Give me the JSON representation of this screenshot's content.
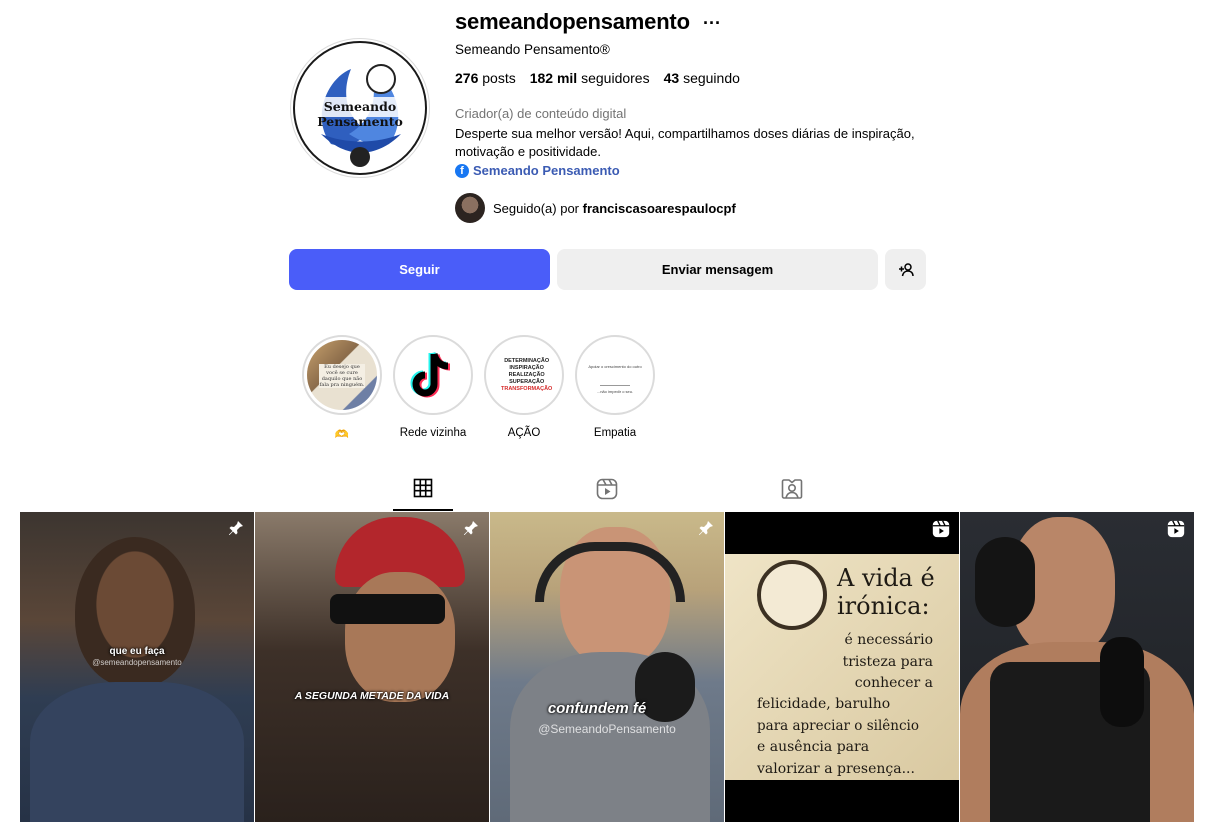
{
  "profile": {
    "username": "semeandopensamento",
    "full_name": "Semeando Pensamento®",
    "avatar_text": "Semeando Pensamento",
    "stats": {
      "posts_count": "276",
      "posts_label": "posts",
      "followers_count": "182 mil",
      "followers_label": "seguidores",
      "following_count": "43",
      "following_label": "seguindo"
    },
    "category": "Criador(a) de conteúdo digital",
    "bio_line1": "Desperte sua melhor versão! Aqui, compartilhamos doses diárias de inspiração,",
    "bio_line2": "motivação e positividade.",
    "link_label": "Semeando Pensamento",
    "followed_by_prefix": "Seguido(a) por",
    "followed_by_user": "franciscasoarespaulocpf"
  },
  "actions": {
    "follow_label": "Seguir",
    "message_label": "Enviar mensagem"
  },
  "highlights": [
    {
      "label": "🫶",
      "cover_text": "Eu desejo que você se cure daquilo que não fala pra ninguém."
    },
    {
      "label": "Rede vizinha"
    },
    {
      "label": "AÇÃO",
      "cover_lines": [
        "DETERMINAÇÃO",
        "INSPIRAÇÃO",
        "REALIZAÇÃO",
        "SUPERAÇÃO",
        "TRANSFORMAÇÃO"
      ]
    },
    {
      "label": "Empatia",
      "cover_text_top": "Apoiar o crescimento do outro",
      "cover_text_bottom": "...não impedir o seu."
    }
  ],
  "tabs": [
    {
      "name": "posts",
      "icon": "grid-icon",
      "active": true
    },
    {
      "name": "reels",
      "icon": "reels-icon",
      "active": false
    },
    {
      "name": "tagged",
      "icon": "tagged-icon",
      "active": false
    }
  ],
  "posts": [
    {
      "caption": "que eu faça",
      "watermark": "@semeandopensamento",
      "badge": "pin-icon"
    },
    {
      "caption": "A SEGUNDA METADE DA VIDA",
      "badge": "pin-icon"
    },
    {
      "caption": "confundem fé",
      "watermark": "@SemeandoPensamento",
      "badge": "pin-icon"
    },
    {
      "title_line1": "A vida é",
      "title_line2": "irónica:",
      "body": [
        "é necessário",
        "tristeza para",
        "conhecer a",
        "felicidade, barulho",
        "para apreciar o silêncio",
        "e ausência para",
        "valorizar a presença..."
      ],
      "badge": "reels-icon"
    },
    {
      "badge": "reels-icon"
    }
  ],
  "colors": {
    "follow_button": "#4a5df9",
    "secondary_button": "#efefef",
    "link": "#3b5bb3",
    "muted_text": "#737373"
  }
}
